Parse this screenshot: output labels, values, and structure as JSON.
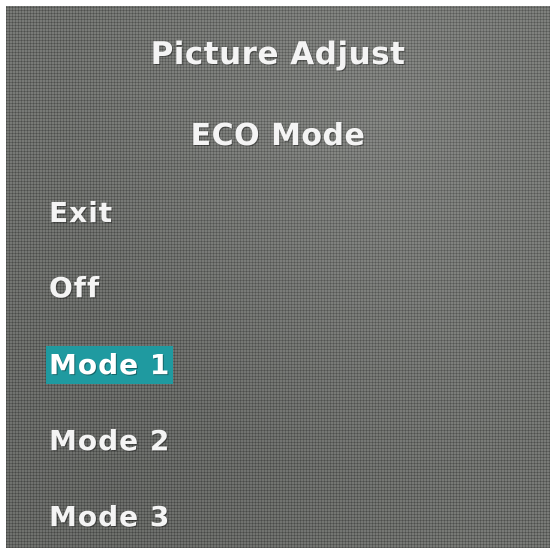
{
  "menu": {
    "title": "Picture Adjust",
    "subtitle": "ECO Mode",
    "items": [
      {
        "label": "Exit",
        "selected": false
      },
      {
        "label": "Off",
        "selected": false
      },
      {
        "label": "Mode 1",
        "selected": true
      },
      {
        "label": "Mode 2",
        "selected": false
      },
      {
        "label": "Mode 3",
        "selected": false
      }
    ],
    "selection_color": "#1f9aa0",
    "background_color": "#6e706c"
  }
}
